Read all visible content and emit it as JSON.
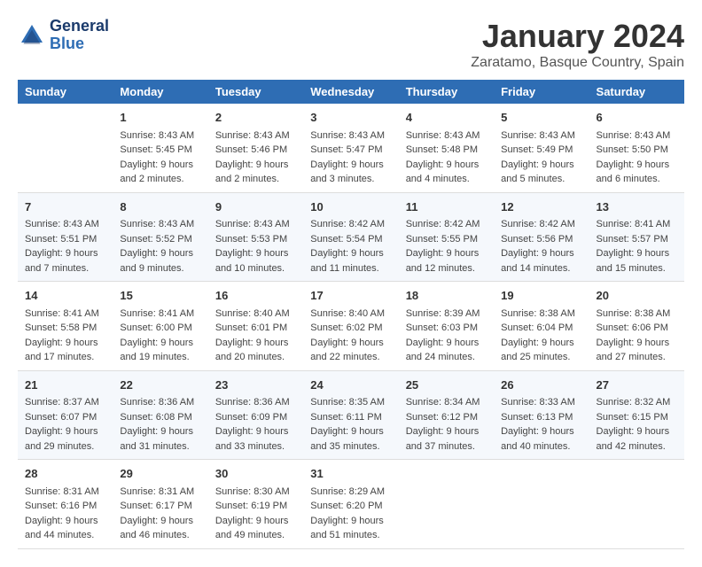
{
  "header": {
    "logo_line1": "General",
    "logo_line2": "Blue",
    "title": "January 2024",
    "subtitle": "Zaratamo, Basque Country, Spain"
  },
  "columns": [
    "Sunday",
    "Monday",
    "Tuesday",
    "Wednesday",
    "Thursday",
    "Friday",
    "Saturday"
  ],
  "weeks": [
    [
      {
        "date": "",
        "info": ""
      },
      {
        "date": "1",
        "info": "Sunrise: 8:43 AM\nSunset: 5:45 PM\nDaylight: 9 hours\nand 2 minutes."
      },
      {
        "date": "2",
        "info": "Sunrise: 8:43 AM\nSunset: 5:46 PM\nDaylight: 9 hours\nand 2 minutes."
      },
      {
        "date": "3",
        "info": "Sunrise: 8:43 AM\nSunset: 5:47 PM\nDaylight: 9 hours\nand 3 minutes."
      },
      {
        "date": "4",
        "info": "Sunrise: 8:43 AM\nSunset: 5:48 PM\nDaylight: 9 hours\nand 4 minutes."
      },
      {
        "date": "5",
        "info": "Sunrise: 8:43 AM\nSunset: 5:49 PM\nDaylight: 9 hours\nand 5 minutes."
      },
      {
        "date": "6",
        "info": "Sunrise: 8:43 AM\nSunset: 5:50 PM\nDaylight: 9 hours\nand 6 minutes."
      }
    ],
    [
      {
        "date": "7",
        "info": "Sunrise: 8:43 AM\nSunset: 5:51 PM\nDaylight: 9 hours\nand 7 minutes."
      },
      {
        "date": "8",
        "info": "Sunrise: 8:43 AM\nSunset: 5:52 PM\nDaylight: 9 hours\nand 9 minutes."
      },
      {
        "date": "9",
        "info": "Sunrise: 8:43 AM\nSunset: 5:53 PM\nDaylight: 9 hours\nand 10 minutes."
      },
      {
        "date": "10",
        "info": "Sunrise: 8:42 AM\nSunset: 5:54 PM\nDaylight: 9 hours\nand 11 minutes."
      },
      {
        "date": "11",
        "info": "Sunrise: 8:42 AM\nSunset: 5:55 PM\nDaylight: 9 hours\nand 12 minutes."
      },
      {
        "date": "12",
        "info": "Sunrise: 8:42 AM\nSunset: 5:56 PM\nDaylight: 9 hours\nand 14 minutes."
      },
      {
        "date": "13",
        "info": "Sunrise: 8:41 AM\nSunset: 5:57 PM\nDaylight: 9 hours\nand 15 minutes."
      }
    ],
    [
      {
        "date": "14",
        "info": "Sunrise: 8:41 AM\nSunset: 5:58 PM\nDaylight: 9 hours\nand 17 minutes."
      },
      {
        "date": "15",
        "info": "Sunrise: 8:41 AM\nSunset: 6:00 PM\nDaylight: 9 hours\nand 19 minutes."
      },
      {
        "date": "16",
        "info": "Sunrise: 8:40 AM\nSunset: 6:01 PM\nDaylight: 9 hours\nand 20 minutes."
      },
      {
        "date": "17",
        "info": "Sunrise: 8:40 AM\nSunset: 6:02 PM\nDaylight: 9 hours\nand 22 minutes."
      },
      {
        "date": "18",
        "info": "Sunrise: 8:39 AM\nSunset: 6:03 PM\nDaylight: 9 hours\nand 24 minutes."
      },
      {
        "date": "19",
        "info": "Sunrise: 8:38 AM\nSunset: 6:04 PM\nDaylight: 9 hours\nand 25 minutes."
      },
      {
        "date": "20",
        "info": "Sunrise: 8:38 AM\nSunset: 6:06 PM\nDaylight: 9 hours\nand 27 minutes."
      }
    ],
    [
      {
        "date": "21",
        "info": "Sunrise: 8:37 AM\nSunset: 6:07 PM\nDaylight: 9 hours\nand 29 minutes."
      },
      {
        "date": "22",
        "info": "Sunrise: 8:36 AM\nSunset: 6:08 PM\nDaylight: 9 hours\nand 31 minutes."
      },
      {
        "date": "23",
        "info": "Sunrise: 8:36 AM\nSunset: 6:09 PM\nDaylight: 9 hours\nand 33 minutes."
      },
      {
        "date": "24",
        "info": "Sunrise: 8:35 AM\nSunset: 6:11 PM\nDaylight: 9 hours\nand 35 minutes."
      },
      {
        "date": "25",
        "info": "Sunrise: 8:34 AM\nSunset: 6:12 PM\nDaylight: 9 hours\nand 37 minutes."
      },
      {
        "date": "26",
        "info": "Sunrise: 8:33 AM\nSunset: 6:13 PM\nDaylight: 9 hours\nand 40 minutes."
      },
      {
        "date": "27",
        "info": "Sunrise: 8:32 AM\nSunset: 6:15 PM\nDaylight: 9 hours\nand 42 minutes."
      }
    ],
    [
      {
        "date": "28",
        "info": "Sunrise: 8:31 AM\nSunset: 6:16 PM\nDaylight: 9 hours\nand 44 minutes."
      },
      {
        "date": "29",
        "info": "Sunrise: 8:31 AM\nSunset: 6:17 PM\nDaylight: 9 hours\nand 46 minutes."
      },
      {
        "date": "30",
        "info": "Sunrise: 8:30 AM\nSunset: 6:19 PM\nDaylight: 9 hours\nand 49 minutes."
      },
      {
        "date": "31",
        "info": "Sunrise: 8:29 AM\nSunset: 6:20 PM\nDaylight: 9 hours\nand 51 minutes."
      },
      {
        "date": "",
        "info": ""
      },
      {
        "date": "",
        "info": ""
      },
      {
        "date": "",
        "info": ""
      }
    ]
  ]
}
